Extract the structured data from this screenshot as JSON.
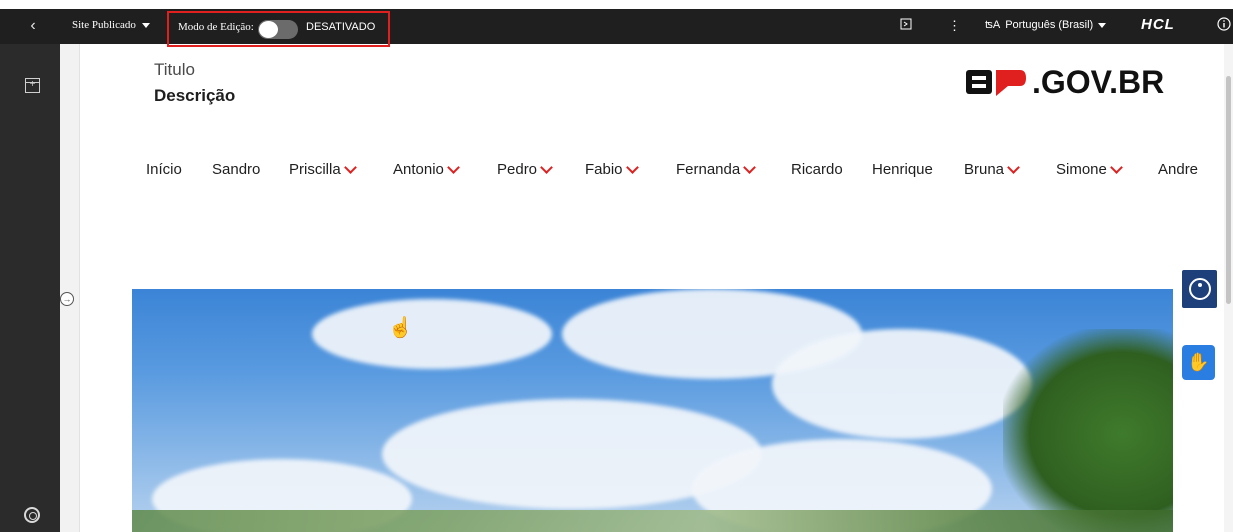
{
  "toolbar": {
    "back_icon": "chevron-left-icon",
    "site_status": "Site Publicado",
    "edit_mode_label": "Modo de Edição:",
    "edit_mode_state": "DESATIVADO",
    "language": "Português (Brasil)",
    "brand": "HCL",
    "highlight_color": "#e0201f"
  },
  "page": {
    "title": "Titulo",
    "description": "Descrição",
    "logo_text": ".GOV.BR",
    "logo_mark": "SP"
  },
  "nav": {
    "items": [
      {
        "label": "Início",
        "has_dropdown": false
      },
      {
        "label": "Sandro",
        "has_dropdown": false
      },
      {
        "label": "Priscilla",
        "has_dropdown": true
      },
      {
        "label": "Antonio",
        "has_dropdown": true
      },
      {
        "label": "Pedro",
        "has_dropdown": true
      },
      {
        "label": "Fabio",
        "has_dropdown": true
      },
      {
        "label": "Fernanda",
        "has_dropdown": true
      },
      {
        "label": "Ricardo",
        "has_dropdown": false
      },
      {
        "label": "Henrique",
        "has_dropdown": false
      },
      {
        "label": "Bruna",
        "has_dropdown": true
      },
      {
        "label": "Simone",
        "has_dropdown": true
      },
      {
        "label": "Andre",
        "has_dropdown": false
      }
    ]
  },
  "colors": {
    "toolbar_bg": "#1f1f1f",
    "sidebar_bg": "#2b2b2b",
    "accent_red": "#e0201f",
    "a11y_blue": "#1d3f7a",
    "libras_blue": "#2a7de1"
  }
}
